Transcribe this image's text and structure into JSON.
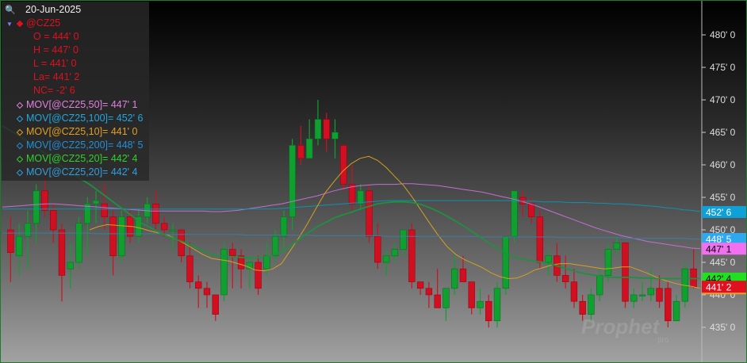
{
  "chart_data": {
    "type": "candlestick",
    "symbol": "@CZ25",
    "date": "20-Jun-2025",
    "y_axis": {
      "ticks": [
        {
          "value": 480,
          "label": "480' 0"
        },
        {
          "value": 475,
          "label": "475' 0"
        },
        {
          "value": 470,
          "label": "470' 0"
        },
        {
          "value": 465,
          "label": "465' 0"
        },
        {
          "value": 460,
          "label": "460' 0"
        },
        {
          "value": 455,
          "label": "455' 0"
        },
        {
          "value": 450,
          "label": "450' 0"
        },
        {
          "value": 445,
          "label": "445' 0"
        },
        {
          "value": 440,
          "label": "440' 0"
        },
        {
          "value": 435,
          "label": "435' 0"
        }
      ]
    },
    "ohlc_readout": {
      "open": "O = 444' 0",
      "high": "H = 447' 0",
      "low": "L = 441' 0",
      "last": "La= 441' 2",
      "net_change": "NC= -2' 6"
    },
    "candles": [
      {
        "o": 450,
        "h": 452,
        "l": 442,
        "c": 446.5
      },
      {
        "o": 446,
        "h": 451,
        "l": 443,
        "c": 449
      },
      {
        "o": 449,
        "h": 453,
        "l": 444,
        "c": 451
      },
      {
        "o": 451,
        "h": 457,
        "l": 448,
        "c": 456
      },
      {
        "o": 456,
        "h": 460,
        "l": 452,
        "c": 453
      },
      {
        "o": 453,
        "h": 454,
        "l": 448,
        "c": 450
      },
      {
        "o": 450,
        "h": 451,
        "l": 439,
        "c": 443
      },
      {
        "o": 444,
        "h": 448,
        "l": 441,
        "c": 445
      },
      {
        "o": 445,
        "h": 452,
        "l": 444,
        "c": 451
      },
      {
        "o": 451,
        "h": 455,
        "l": 446,
        "c": 454
      },
      {
        "o": 454,
        "h": 456,
        "l": 451,
        "c": 454.5
      },
      {
        "o": 454,
        "h": 457,
        "l": 450,
        "c": 452
      },
      {
        "o": 452,
        "h": 453,
        "l": 443,
        "c": 446
      },
      {
        "o": 446,
        "h": 453,
        "l": 445,
        "c": 452
      },
      {
        "o": 452,
        "h": 453,
        "l": 448,
        "c": 449
      },
      {
        "o": 449,
        "h": 453,
        "l": 448,
        "c": 452
      },
      {
        "o": 452,
        "h": 455,
        "l": 451,
        "c": 454
      },
      {
        "o": 454,
        "h": 456,
        "l": 450,
        "c": 451
      },
      {
        "o": 451,
        "h": 452,
        "l": 449,
        "c": 450
      },
      {
        "o": 450,
        "h": 451,
        "l": 447,
        "c": 450
      },
      {
        "o": 450,
        "h": 450,
        "l": 445,
        "c": 446
      },
      {
        "o": 446,
        "h": 448,
        "l": 441,
        "c": 442
      },
      {
        "o": 442,
        "h": 443,
        "l": 438,
        "c": 441
      },
      {
        "o": 441,
        "h": 442,
        "l": 438,
        "c": 440
      },
      {
        "o": 440,
        "h": 440,
        "l": 436,
        "c": 437
      },
      {
        "o": 440,
        "h": 448,
        "l": 439,
        "c": 447
      },
      {
        "o": 447,
        "h": 448,
        "l": 441,
        "c": 446
      },
      {
        "o": 446,
        "h": 447,
        "l": 441,
        "c": 444
      },
      {
        "o": 444,
        "h": 446,
        "l": 441,
        "c": 445
      },
      {
        "o": 445,
        "h": 446,
        "l": 440,
        "c": 441
      },
      {
        "o": 444,
        "h": 448,
        "l": 443,
        "c": 446
      },
      {
        "o": 446,
        "h": 450,
        "l": 445,
        "c": 449
      },
      {
        "o": 449,
        "h": 453,
        "l": 447,
        "c": 452
      },
      {
        "o": 452,
        "h": 464,
        "l": 450,
        "c": 463
      },
      {
        "o": 463,
        "h": 466,
        "l": 460,
        "c": 461
      },
      {
        "o": 461,
        "h": 467,
        "l": 461,
        "c": 464
      },
      {
        "o": 464,
        "h": 470,
        "l": 463,
        "c": 467
      },
      {
        "o": 467,
        "h": 468,
        "l": 462,
        "c": 464
      },
      {
        "o": 464,
        "h": 467,
        "l": 461,
        "c": 465
      },
      {
        "o": 463,
        "h": 463,
        "l": 456,
        "c": 457
      },
      {
        "o": 457,
        "h": 460,
        "l": 453,
        "c": 454
      },
      {
        "o": 454,
        "h": 457,
        "l": 453,
        "c": 456
      },
      {
        "o": 456,
        "h": 457,
        "l": 448,
        "c": 449
      },
      {
        "o": 449,
        "h": 451,
        "l": 444,
        "c": 445
      },
      {
        "o": 445,
        "h": 447,
        "l": 443,
        "c": 446
      },
      {
        "o": 446,
        "h": 448,
        "l": 445,
        "c": 447
      },
      {
        "o": 447,
        "h": 450,
        "l": 446,
        "c": 450
      },
      {
        "o": 450,
        "h": 451,
        "l": 441,
        "c": 442
      },
      {
        "o": 442,
        "h": 442,
        "l": 440,
        "c": 441
      },
      {
        "o": 441,
        "h": 442,
        "l": 438,
        "c": 440
      },
      {
        "o": 440,
        "h": 444,
        "l": 439,
        "c": 438
      },
      {
        "o": 438,
        "h": 441,
        "l": 436,
        "c": 441
      },
      {
        "o": 441,
        "h": 446,
        "l": 440,
        "c": 444
      },
      {
        "o": 444,
        "h": 446,
        "l": 442,
        "c": 442
      },
      {
        "o": 442,
        "h": 442,
        "l": 437,
        "c": 438
      },
      {
        "o": 438,
        "h": 441,
        "l": 437,
        "c": 439
      },
      {
        "o": 439,
        "h": 440,
        "l": 435,
        "c": 436
      },
      {
        "o": 436,
        "h": 442,
        "l": 435,
        "c": 441
      },
      {
        "o": 441,
        "h": 449,
        "l": 440,
        "c": 449
      },
      {
        "o": 449,
        "h": 456,
        "l": 448,
        "c": 456
      },
      {
        "o": 455,
        "h": 456,
        "l": 452,
        "c": 454
      },
      {
        "o": 454,
        "h": 455,
        "l": 451,
        "c": 452
      },
      {
        "o": 452,
        "h": 453,
        "l": 444,
        "c": 445
      },
      {
        "o": 445,
        "h": 447,
        "l": 443,
        "c": 446
      },
      {
        "o": 446,
        "h": 448,
        "l": 442,
        "c": 443
      },
      {
        "o": 443,
        "h": 446,
        "l": 441,
        "c": 442
      },
      {
        "o": 442,
        "h": 444,
        "l": 438,
        "c": 439
      },
      {
        "o": 439,
        "h": 440,
        "l": 436,
        "c": 437
      },
      {
        "o": 437,
        "h": 441,
        "l": 436,
        "c": 440
      },
      {
        "o": 440,
        "h": 444,
        "l": 439,
        "c": 443
      },
      {
        "o": 443,
        "h": 448,
        "l": 442,
        "c": 447
      },
      {
        "o": 447,
        "h": 449,
        "l": 446,
        "c": 448
      },
      {
        "o": 448,
        "h": 448,
        "l": 438,
        "c": 439
      },
      {
        "o": 439,
        "h": 441,
        "l": 438,
        "c": 440
      },
      {
        "o": 440,
        "h": 442,
        "l": 439,
        "c": 440
      },
      {
        "o": 440,
        "h": 444,
        "l": 439,
        "c": 441
      },
      {
        "o": 441,
        "h": 443,
        "l": 438,
        "c": 439
      },
      {
        "o": 441,
        "h": 442,
        "l": 435,
        "c": 436
      },
      {
        "o": 436,
        "h": 440,
        "l": 436,
        "c": 439
      },
      {
        "o": 439,
        "h": 445,
        "l": 438,
        "c": 444
      },
      {
        "o": 444,
        "h": 447,
        "l": 441,
        "c": 441.25
      }
    ],
    "series": [
      {
        "name": "MOV[@CZ25,50]",
        "readout": "447' 1",
        "color": "#c070d0",
        "values": [
          453.5,
          453.6,
          453.7,
          453.8,
          453.9,
          454,
          454,
          453.9,
          453.8,
          453.7,
          453.6,
          453.5,
          453.4,
          453.3,
          453.2,
          453.1,
          453,
          452.9,
          452.9,
          452.9,
          452.9,
          452.9,
          452.9,
          452.9,
          452.8,
          452.8,
          452.9,
          453,
          453.2,
          453.4,
          453.6,
          453.8,
          454,
          454.3,
          454.6,
          454.9,
          455.2,
          455.6,
          456,
          456.3,
          456.6,
          456.8,
          456.9,
          457,
          457,
          457,
          457.1,
          457.1,
          457,
          456.9,
          456.8,
          456.6,
          456.4,
          456.2,
          456,
          455.8,
          455.5,
          455.2,
          454.9,
          454.6,
          454.2,
          453.8,
          453.3,
          452.8,
          452.3,
          451.8,
          451.3,
          450.8,
          450.3,
          449.9,
          449.5,
          449.1,
          448.8,
          448.5,
          448.2,
          448,
          447.8,
          447.6,
          447.4,
          447.2,
          447.1
        ]
      },
      {
        "name": "MOV[@CZ25,100]",
        "readout": "452' 6",
        "color": "#1090b0",
        "values": [
          453.2,
          453.2,
          453.2,
          453.2,
          453.2,
          453.2,
          453.2,
          453.2,
          453.2,
          453.2,
          453.2,
          453.2,
          453.2,
          453.2,
          453.2,
          453.2,
          453.2,
          453.2,
          453.2,
          453.2,
          453.2,
          453.2,
          453.2,
          453.2,
          453.2,
          453.2,
          453.2,
          453.2,
          453.2,
          453.2,
          453.2,
          453.2,
          453.3,
          453.4,
          453.5,
          453.6,
          453.7,
          453.8,
          453.9,
          454,
          454.1,
          454.2,
          454.3,
          454.4,
          454.5,
          454.5,
          454.5,
          454.5,
          454.5,
          454.5,
          454.5,
          454.5,
          454.5,
          454.5,
          454.5,
          454.5,
          454.5,
          454.5,
          454.5,
          454.4,
          454.4,
          454.4,
          454.3,
          454.3,
          454.3,
          454.2,
          454.2,
          454.2,
          454.1,
          454.1,
          454,
          454,
          453.9,
          453.8,
          453.7,
          453.6,
          453.4,
          453.3,
          453.1,
          453,
          452.8
        ]
      },
      {
        "name": "MOV[@CZ25,10]",
        "readout": "441' 0",
        "color": "#d4a020",
        "values": [
          null,
          null,
          null,
          null,
          null,
          null,
          null,
          null,
          null,
          null,
          450,
          450.5,
          450.8,
          450.7,
          450.6,
          450.5,
          450.2,
          449.8,
          449.5,
          449.2,
          448.5,
          447.8,
          447,
          446.2,
          445.6,
          445.4,
          445.2,
          444.8,
          444.4,
          443.8,
          443.7,
          444,
          444.8,
          446.8,
          448.8,
          451,
          453.4,
          455.7,
          457.4,
          459,
          460.2,
          461,
          461.3,
          460.7,
          459.6,
          458.2,
          456.8,
          455,
          453,
          451,
          449.1,
          447.4,
          446.2,
          445.4,
          444.8,
          444.2,
          443.4,
          442.8,
          442.5,
          442.6,
          443.1,
          443.8,
          444.2,
          444.6,
          444.8,
          444.8,
          444.6,
          444.4,
          444.2,
          444,
          444.1,
          444.3,
          444.3,
          443.8,
          443.3,
          442.7,
          442.2,
          441.8,
          441.5,
          441.3,
          441
        ]
      },
      {
        "name": "MOV[@CZ25,200]",
        "readout": "448' 5",
        "color": "#3a7fa0",
        "values": [
          449.5,
          449.5,
          449.5,
          449.5,
          449.5,
          449.5,
          449.5,
          449.5,
          449.5,
          449.5,
          449.5,
          449.4,
          449.4,
          449.4,
          449.4,
          449.4,
          449.4,
          449.4,
          449.4,
          449.3,
          449.3,
          449.3,
          449.3,
          449.3,
          449.3,
          449.3,
          449.3,
          449.3,
          449.2,
          449.2,
          449.2,
          449.2,
          449.2,
          449.2,
          449.2,
          449.2,
          449.1,
          449.1,
          449.1,
          449.1,
          449.1,
          449.1,
          449.1,
          449.1,
          449,
          449,
          449,
          449,
          449,
          449,
          449,
          449,
          449,
          449,
          449,
          448.9,
          448.9,
          448.9,
          448.9,
          448.9,
          448.9,
          448.9,
          448.9,
          448.9,
          448.8,
          448.8,
          448.8,
          448.8,
          448.8,
          448.8,
          448.8,
          448.8,
          448.7,
          448.7,
          448.7,
          448.7,
          448.7,
          448.7,
          448.7,
          448.6,
          448.6
        ]
      },
      {
        "name": "MOV[@CZ25,20]",
        "readout": "442' 4",
        "color": "#209040",
        "values": [
          466,
          465.2,
          464.4,
          463.5,
          462.6,
          461.6,
          460.6,
          459.6,
          458.7,
          457.8,
          457,
          456,
          455,
          454,
          453,
          452,
          451,
          450.3,
          449.6,
          449,
          448.5,
          448,
          447.4,
          446.8,
          446.2,
          446,
          445.9,
          445.8,
          445.7,
          445.7,
          445.8,
          446.1,
          446.6,
          447.5,
          448.5,
          449.5,
          450.4,
          451.1,
          451.8,
          452.3,
          452.7,
          453.2,
          453.6,
          454,
          454.2,
          454.3,
          454.3,
          454.2,
          453.9,
          453.4,
          452.8,
          452.1,
          451.3,
          450.5,
          449.6,
          448.7,
          447.8,
          446.9,
          446.2,
          445.7,
          445.4,
          445.2,
          445,
          444.7,
          444.3,
          443.9,
          443.5,
          443.2,
          443,
          442.8,
          442.7,
          442.7,
          442.7,
          442.6,
          442.6,
          442.5,
          442.5,
          442.5,
          442.5,
          442.5,
          442.5
        ]
      }
    ],
    "price_labels": [
      {
        "text": "452' 6",
        "bg": "#10a0d8",
        "fg": "#ffffff",
        "value": 452.75
      },
      {
        "text": "448' 5",
        "bg": "#30a8f0",
        "fg": "#ffffff",
        "value": 448.6
      },
      {
        "text": "447' 1",
        "bg": "#f070f0",
        "fg": "#000000",
        "value": 447.1
      },
      {
        "text": "442' 4",
        "bg": "#20e020",
        "fg": "#000000",
        "value": 442.5
      },
      {
        "text": "441' 0",
        "bg": "#e8a020",
        "fg": "#000000",
        "value": 441.0
      },
      {
        "text": "441' 2",
        "bg": "#e01020",
        "fg": "#ffffff",
        "value": 441.25
      }
    ],
    "legend": [
      {
        "text": "MOV[@CZ25,50]= 447' 1",
        "color": "#e080e0"
      },
      {
        "text": "MOV[@CZ25,100]= 452' 6",
        "color": "#20a8e0"
      },
      {
        "text": "MOV[@CZ25,10]= 441' 0",
        "color": "#e0a020"
      },
      {
        "text": "MOV[@CZ25,200]= 448' 5",
        "color": "#2090d8"
      },
      {
        "text": "MOV[@CZ25,20]= 442' 4",
        "color": "#30d030"
      },
      {
        "text": "MOV[@CZ25,20]= 442' 4",
        "color": "#30a0e0"
      }
    ],
    "colors": {
      "up": "#10a030",
      "down": "#d01020",
      "axis_text": "#dddddd",
      "ohlc_text": "#e0101e"
    },
    "watermark": {
      "main": "Prophet",
      "sub": "pro"
    }
  }
}
